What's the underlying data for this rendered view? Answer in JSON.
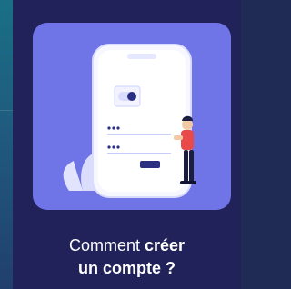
{
  "card": {
    "caption_prefix": "Comment ",
    "caption_strong_1": "créer",
    "caption_strong_2": "un compte ?"
  },
  "colors": {
    "page_bg": "#1f2a55",
    "card_bg": "#22225a",
    "hero_bg": "#6f74e6",
    "accent": "#2b2f84"
  },
  "icons": {
    "illustration": "person-with-phone-illustration",
    "toggle": "toggle-icon"
  }
}
